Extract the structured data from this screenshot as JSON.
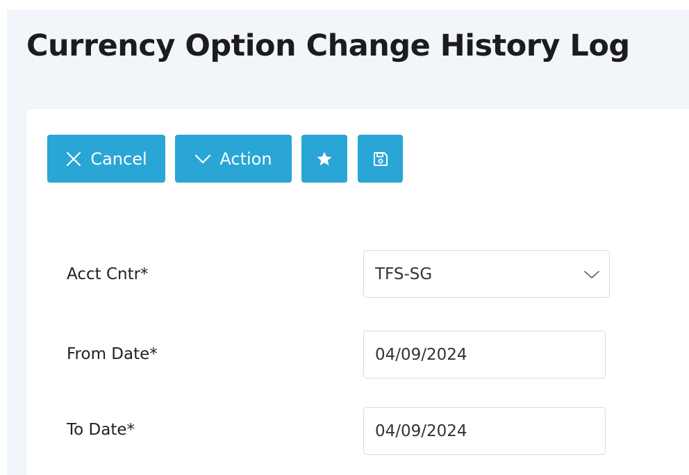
{
  "page": {
    "title": "Currency Option Change History Log"
  },
  "toolbar": {
    "cancel_label": "Cancel",
    "action_label": "Action",
    "cancel_icon": "close-icon",
    "action_icon": "chevron-down-icon",
    "favorite_icon": "star-icon",
    "save_icon": "floppy-disk-icon"
  },
  "form": {
    "acct_cntr": {
      "label": "Acct Cntr*",
      "value": "TFS-SG"
    },
    "from_date": {
      "label": "From Date*",
      "value": "04/09/2024"
    },
    "to_date": {
      "label": "To Date*",
      "value": "04/09/2024"
    }
  },
  "colors": {
    "button_bg": "#29a6d6",
    "header_bg": "#f2f5f9",
    "field_border": "#d5dbe3",
    "title_text": "#1c1c1c"
  }
}
